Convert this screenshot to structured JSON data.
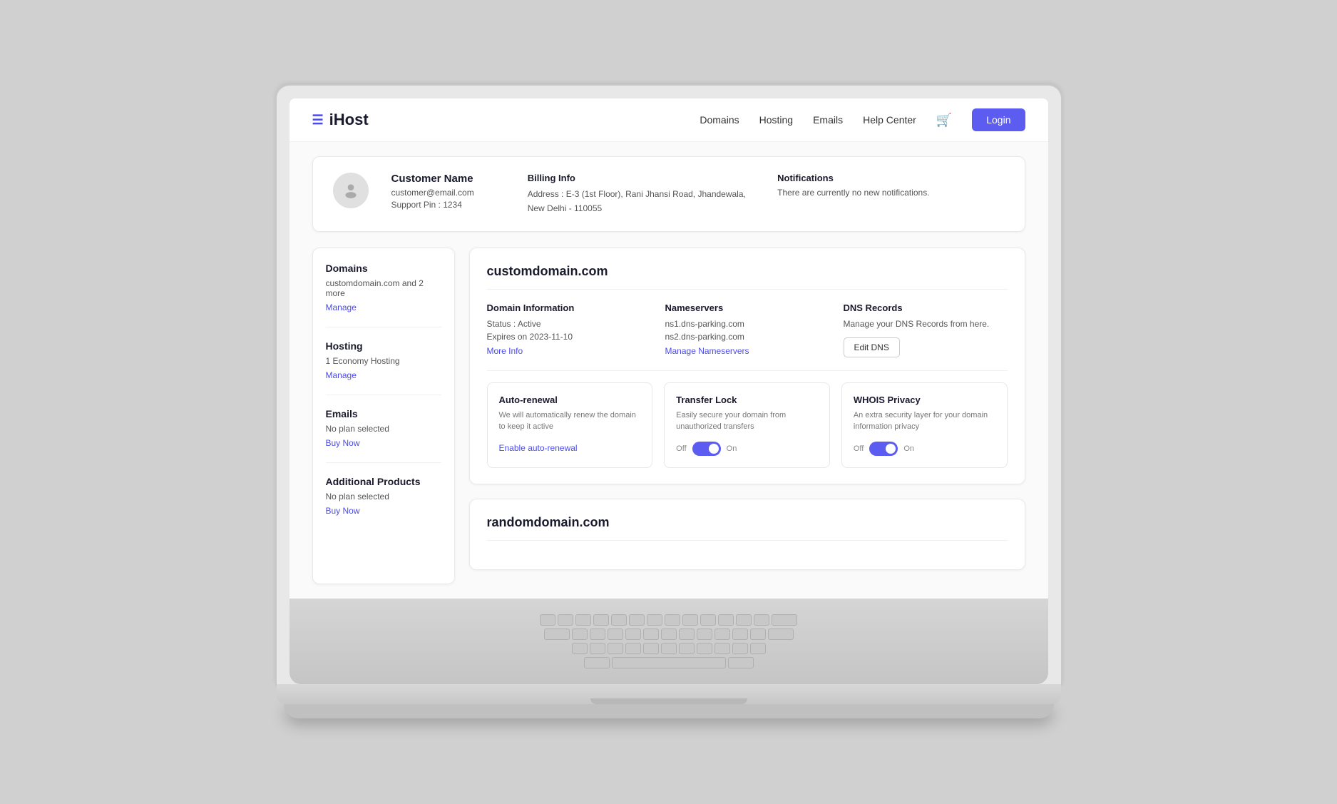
{
  "logo": {
    "icon": "☰",
    "text": "iHost"
  },
  "nav": {
    "links": [
      "Domains",
      "Hosting",
      "Emails",
      "Help Center"
    ],
    "cart_icon": "🛒",
    "login_label": "Login"
  },
  "customer": {
    "name": "Customer Name",
    "email": "customer@email.com",
    "support_pin": "Support Pin : 1234",
    "billing_title": "Billing Info",
    "billing_address": "Address : E-3 (1st Floor), Rani Jhansi Road, Jhandewala, New Delhi - 110055",
    "notifications_title": "Notifications",
    "notifications_text": "There are currently no new notifications."
  },
  "sidebar": {
    "domains_label": "Domains",
    "domains_value": "customdomain.com and 2 more",
    "domains_link": "Manage",
    "hosting_label": "Hosting",
    "hosting_value": "1 Economy Hosting",
    "hosting_link": "Manage",
    "emails_label": "Emails",
    "emails_value": "No plan selected",
    "emails_link": "Buy Now",
    "additional_label": "Additional Products",
    "additional_value": "No plan selected",
    "additional_link": "Buy Now"
  },
  "domain1": {
    "name": "customdomain.com",
    "info_title": "Domain Information",
    "status": "Status : Active",
    "expires": "Expires on 2023-11-10",
    "more_info": "More Info",
    "nameservers_title": "Nameservers",
    "ns1": "ns1.dns-parking.com",
    "ns2": "ns2.dns-parking.com",
    "manage_ns": "Manage Nameservers",
    "dns_title": "DNS Records",
    "dns_desc": "Manage your DNS Records from here.",
    "edit_dns": "Edit DNS",
    "auto_renewal_title": "Auto-renewal",
    "auto_renewal_desc": "We will automatically renew the domain to keep it active",
    "auto_renewal_action": "Enable auto-renewal",
    "transfer_lock_title": "Transfer Lock",
    "transfer_lock_desc": "Easily secure your domain from unauthorized transfers",
    "transfer_lock_off": "Off",
    "transfer_lock_on": "On",
    "whois_title": "WHOIS Privacy",
    "whois_desc": "An extra security layer for your domain information privacy",
    "whois_off": "Off",
    "whois_on": "On"
  },
  "domain2": {
    "name": "randomdomain.com"
  }
}
